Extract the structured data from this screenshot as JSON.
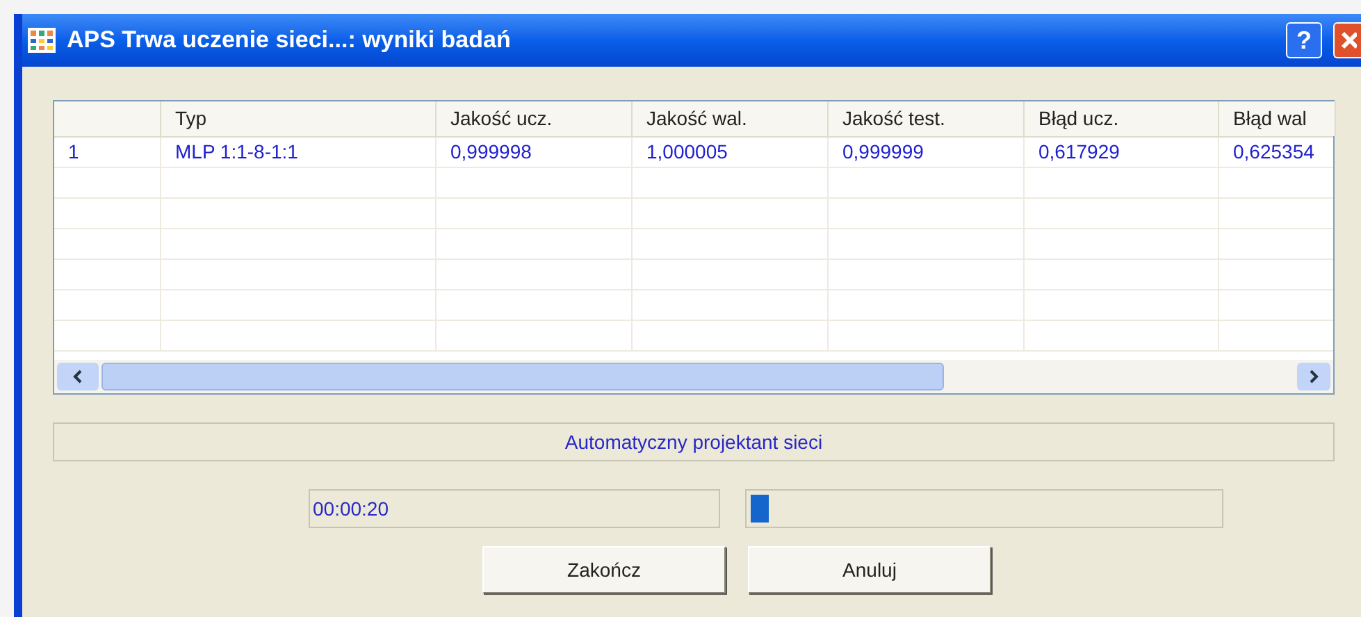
{
  "window": {
    "title": "APS Trwa uczenie sieci...: wyniki badań",
    "help_button": "?"
  },
  "table": {
    "columns": [
      "",
      "Typ",
      "Jakość ucz.",
      "Jakość wal.",
      "Jakość test.",
      "Błąd ucz.",
      "Błąd wal"
    ],
    "rows": [
      [
        "1",
        "MLP 1:1-8-1:1",
        "0,999998",
        "1,000005",
        "0,999999",
        "0,617929",
        "0,625354"
      ]
    ]
  },
  "status": "Automatyczny projektant sieci",
  "timer": {
    "value": "00:00:20"
  },
  "progress": {
    "level": 0.04
  },
  "buttons": [
    "Zakończ",
    "Anuluj"
  ]
}
